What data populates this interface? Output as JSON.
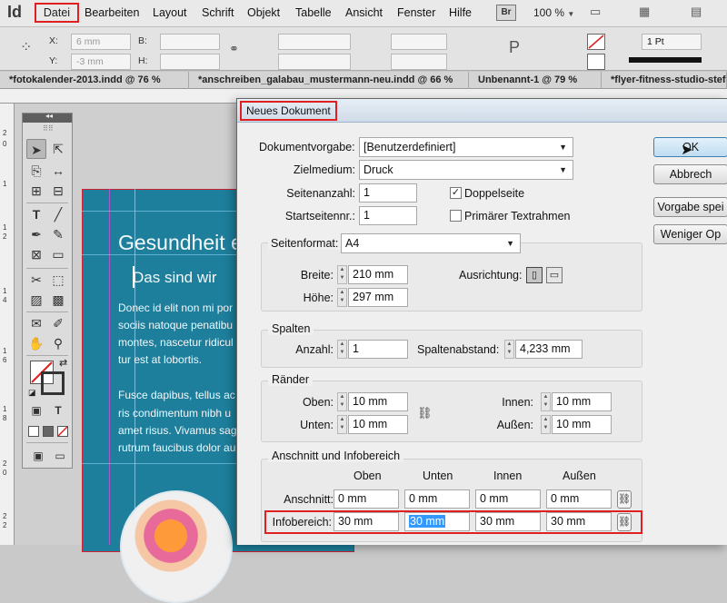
{
  "app": {
    "logo": "Id"
  },
  "menubar": {
    "items": [
      "Datei",
      "Bearbeiten",
      "Layout",
      "Schrift",
      "Objekt",
      "Tabelle",
      "Ansicht",
      "Fenster",
      "Hilfe"
    ],
    "br_badge": "Br",
    "zoom": "100 %"
  },
  "controlbar": {
    "x_label": "X:",
    "x_value": "6 mm",
    "y_label": "Y:",
    "y_value": "-3 mm",
    "b_label": "B:",
    "h_label": "H:",
    "stroke_weight": "1 Pt"
  },
  "tabs": [
    "*fotokalender-2013.indd @ 76 %",
    "*anschreiben_galabau_mustermann-neu.indd @ 66 %",
    "Unbenannt-1 @ 79 %",
    "*flyer-fitness-studio-stefan"
  ],
  "ruler_numbers": [
    "2",
    "0",
    "1",
    "1",
    "2",
    "1",
    "4",
    "1",
    "6",
    "1",
    "8",
    "2",
    "0",
    "2",
    "2"
  ],
  "document": {
    "headline": "Gesundheit e",
    "subhead": "Das sind wir",
    "body1": [
      "Donec id elit non mi por",
      "sociis natoque penatibu",
      "montes, nascetur ridicul",
      "tur est at lobortis."
    ],
    "body2": [
      "Fusce dapibus, tellus ac",
      "ris condimentum nibh u",
      "amet risus. Vivamus sag",
      "rutrum faucibus dolor au"
    ]
  },
  "dialog": {
    "title": "Neues Dokument",
    "dokumentvorgabe_label": "Dokumentvorgabe:",
    "dokumentvorgabe_value": "[Benutzerdefiniert]",
    "zielmedium_label": "Zielmedium:",
    "zielmedium_value": "Druck",
    "seitenanzahl_label": "Seitenanzahl:",
    "seitenanzahl_value": "1",
    "startseite_label": "Startseitennr.:",
    "startseite_value": "1",
    "doppelseite_label": "Doppelseite",
    "doppelseite_checked": "✓",
    "textrahmen_label": "Primärer Textrahmen",
    "seitenformat_label": "Seitenformat:",
    "seitenformat_value": "A4",
    "breite_label": "Breite:",
    "breite_value": "210 mm",
    "hoehe_label": "Höhe:",
    "hoehe_value": "297 mm",
    "ausrichtung_label": "Ausrichtung:",
    "spalten_title": "Spalten",
    "anzahl_label": "Anzahl:",
    "anzahl_value": "1",
    "spaltenabstand_label": "Spaltenabstand:",
    "spaltenabstand_value": "4,233 mm",
    "raender_title": "Ränder",
    "oben_label": "Oben:",
    "oben_value": "10 mm",
    "unten_label": "Unten:",
    "unten_value": "10 mm",
    "innen_label": "Innen:",
    "innen_value": "10 mm",
    "aussen_label": "Außen:",
    "aussen_value": "10 mm",
    "anschnitt_title": "Anschnitt und Infobereich",
    "col_oben": "Oben",
    "col_unten": "Unten",
    "col_innen": "Innen",
    "col_aussen": "Außen",
    "anschnitt_label": "Anschnitt:",
    "anschnitt_values": [
      "0 mm",
      "0 mm",
      "0 mm",
      "0 mm"
    ],
    "infobereich_label": "Infobereich:",
    "infobereich_values": [
      "30 mm",
      "30 mm",
      "30 mm",
      "30 mm"
    ],
    "buttons": {
      "ok": "OK",
      "abbrechen": "Abbrech",
      "vorgabe": "Vorgabe spei",
      "weniger": "Weniger Op"
    }
  },
  "colors": {
    "highlight_red": "#e02020",
    "page_teal": "#1d7f9c",
    "selection_blue": "#3399ff"
  }
}
